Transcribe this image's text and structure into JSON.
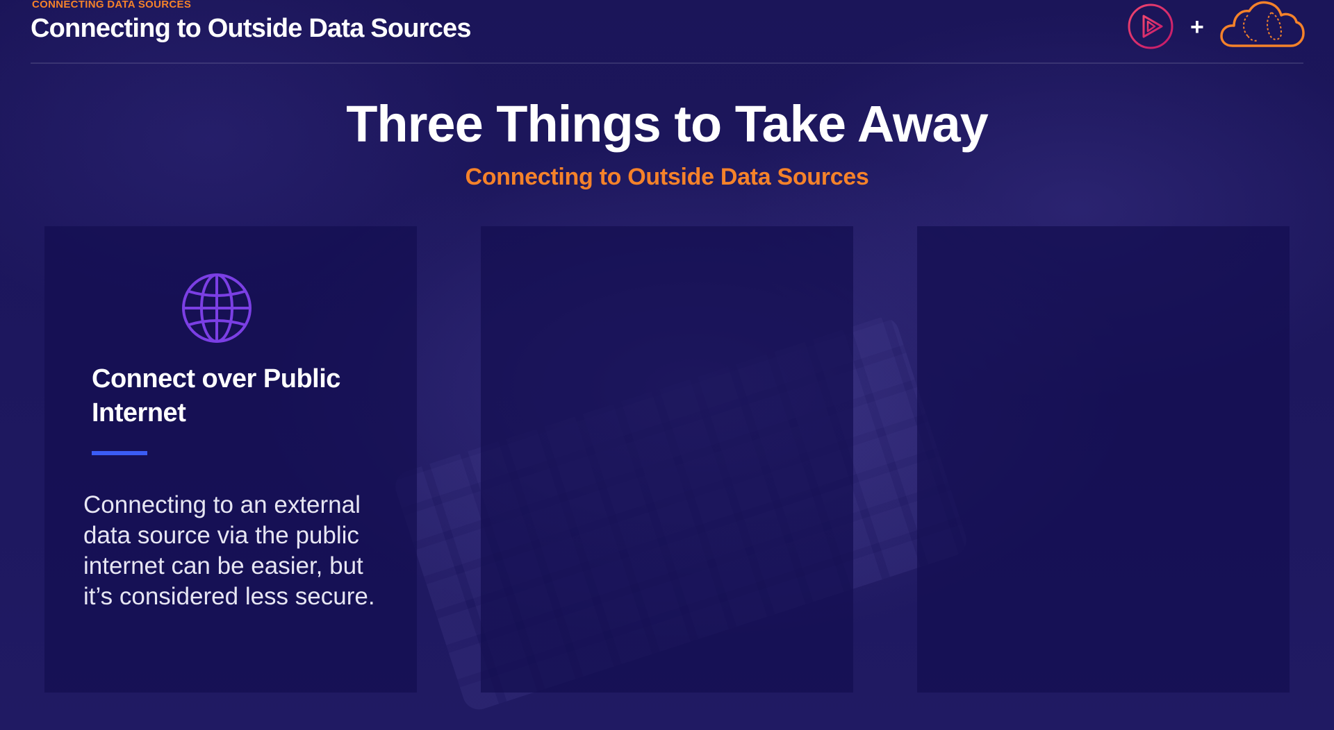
{
  "header": {
    "kicker": "CONNECTING DATA SOURCES",
    "title": "Connecting to Outside Data Sources",
    "logos": {
      "play_icon": "play-circle-icon",
      "plus": "+",
      "cloud_icon": "cloud-icon"
    }
  },
  "slide": {
    "title": "Three Things to Take Away",
    "subtitle": "Connecting to Outside Data Sources"
  },
  "cards": [
    {
      "icon": "globe-icon",
      "heading": "Connect over Public Internet",
      "body": "Connecting to an external data source via the public internet can be easier, but it’s considered less secure."
    },
    {},
    {}
  ],
  "colors": {
    "background": "#1a1456",
    "accent_orange": "#f5822a",
    "accent_purple": "#7b3fe4",
    "accent_blue": "#3b5cf5",
    "logo_pink": "#e2246a"
  }
}
